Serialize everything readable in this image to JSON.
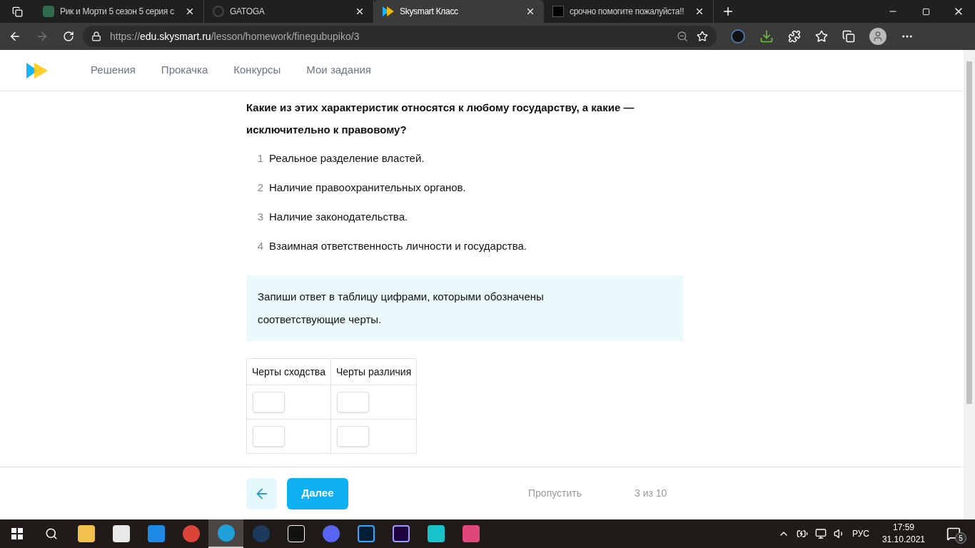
{
  "browser": {
    "tabs": [
      {
        "title": "Рик и Морти 5 сезон 5 серия с",
        "selected": false,
        "kind": "rm"
      },
      {
        "title": "GATOGA",
        "selected": false,
        "kind": "circle"
      },
      {
        "title": "Skysmart Класс",
        "selected": true,
        "kind": "sky"
      },
      {
        "title": "срочно помогите пожалуйста!!",
        "selected": false,
        "kind": "z"
      }
    ],
    "url_prefix": "https://",
    "url_host": "edu.skysmart.ru",
    "url_path": "/lesson/homework/finegubupiko/3"
  },
  "site_nav": [
    {
      "label": "Решения"
    },
    {
      "label": "Прокачка"
    },
    {
      "label": "Конкурсы"
    },
    {
      "label": "Мои задания"
    }
  ],
  "question": "Какие из этих характеристик относятся к любому государству, а какие — исключительно к правовому?",
  "items": [
    {
      "number": "1",
      "text": "Реальное разделение властей."
    },
    {
      "number": "2",
      "text": "Наличие правоохранительных органов."
    },
    {
      "number": "3",
      "text": "Наличие законодательства."
    },
    {
      "number": "4",
      "text": "Взаимная ответственность личности и государства."
    }
  ],
  "instruction": "Запиши ответ в таблицу цифрами, которыми обозначены соответствующие черты.",
  "answer_table": {
    "columns": [
      "Черты сходства",
      "Черты различия"
    ],
    "rows": [
      {
        "cells": [
          {
            "kind": "input"
          },
          {
            "kind": "input"
          }
        ]
      },
      {
        "cells": [
          {
            "kind": "input"
          },
          {
            "kind": "input"
          }
        ]
      }
    ]
  },
  "footer": {
    "next_button": "Далее",
    "skip_link": "Пропустить",
    "progress": "3 из 10"
  },
  "taskbar": {
    "apps": [
      {
        "kind": "folder",
        "selected": false
      },
      {
        "kind": "store",
        "selected": false
      },
      {
        "kind": "mail",
        "selected": false
      },
      {
        "kind": "chrome",
        "selected": false
      },
      {
        "kind": "edge",
        "selected": true
      },
      {
        "kind": "steam",
        "selected": false
      },
      {
        "kind": "epic",
        "selected": false
      },
      {
        "kind": "discord",
        "selected": false
      },
      {
        "kind": "ps",
        "selected": false
      },
      {
        "kind": "ae",
        "selected": false
      },
      {
        "kind": "vpn",
        "selected": false
      },
      {
        "kind": "cube",
        "selected": false
      }
    ],
    "language": "РУС",
    "time": "17:59",
    "date": "31.10.2021",
    "notifications": "5"
  }
}
